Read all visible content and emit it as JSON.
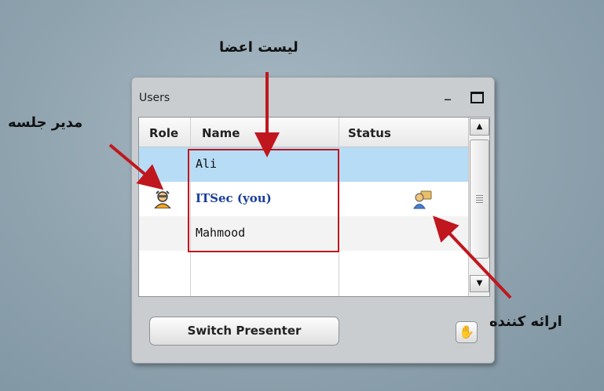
{
  "panel": {
    "title": "Users",
    "minimize_label": "_"
  },
  "grid": {
    "headers": {
      "role": "Role",
      "name": "Name",
      "status": "Status"
    },
    "rows": [
      {
        "name": "Ali",
        "selected": true
      },
      {
        "name": "ITSec (you)",
        "role_icon": "moderator-icon",
        "status_icon": "presenter-icon"
      },
      {
        "name": "Mahmood"
      }
    ],
    "scroll_up": "▲",
    "scroll_down": "▼"
  },
  "buttons": {
    "switch_presenter": "Switch Presenter",
    "raise_hand_icon": "hand-icon"
  },
  "annotations": {
    "members_list": "لیست اعضا",
    "session_manager": "مدیر جلسه",
    "presenter": "ارائه کننده",
    "highlight_color": "#c0171f"
  }
}
